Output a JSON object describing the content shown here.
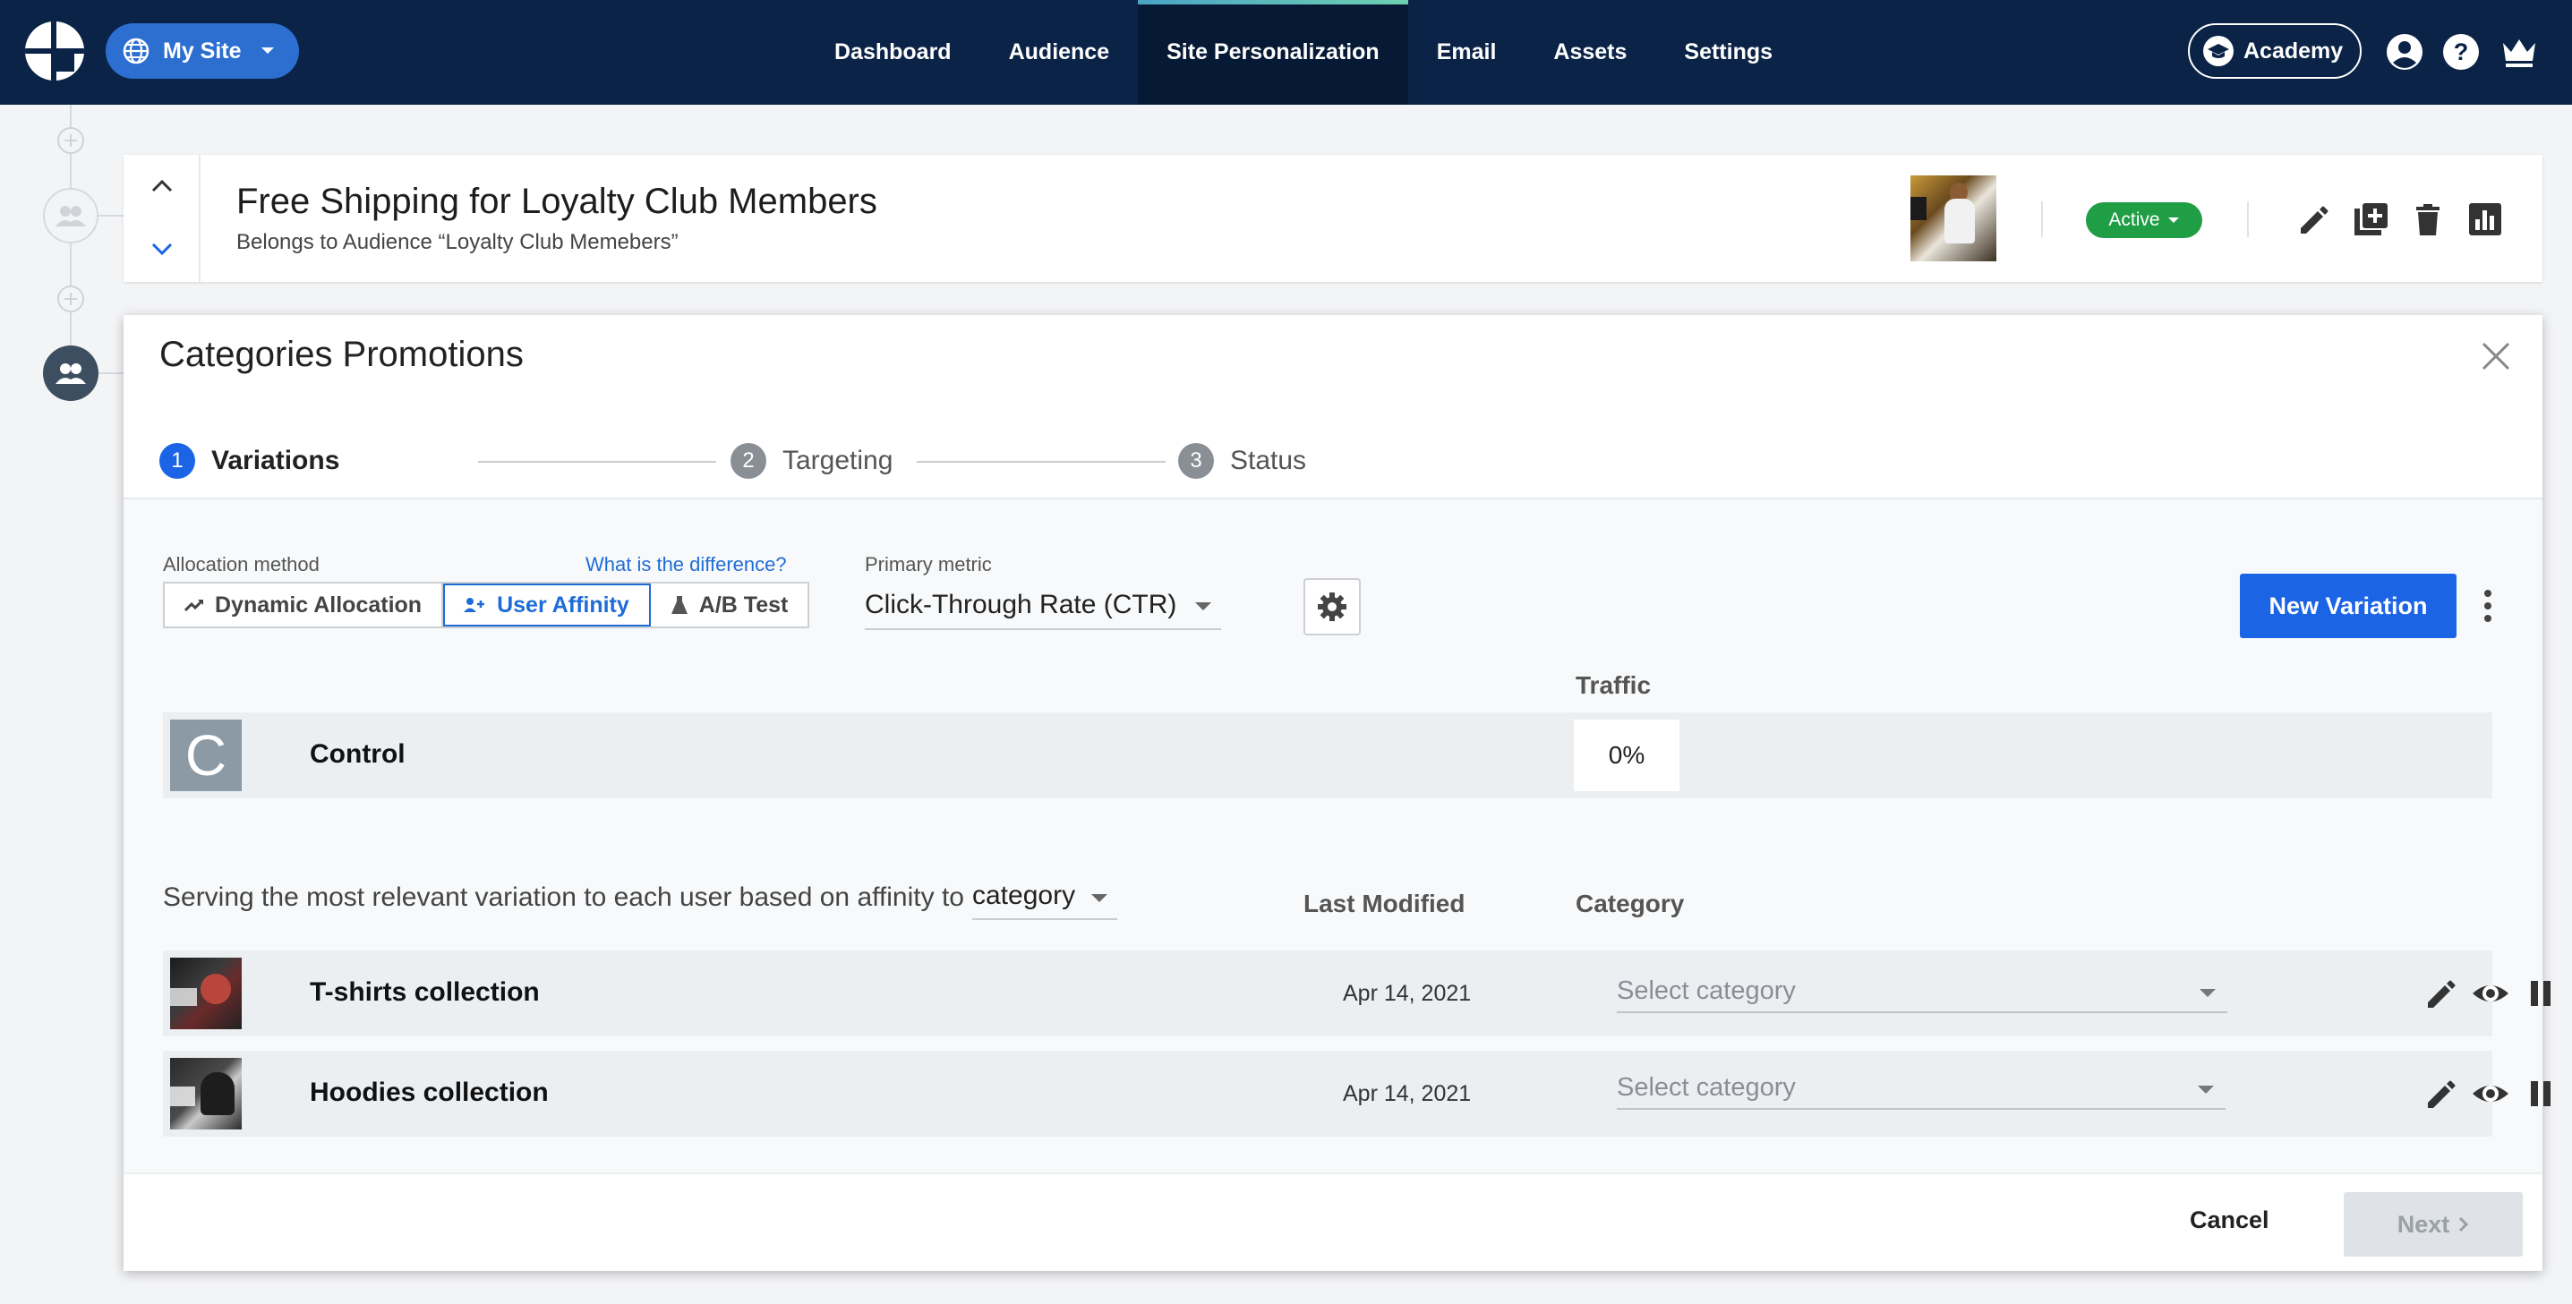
{
  "topbar": {
    "site_label": "My Site",
    "nav": [
      "Dashboard",
      "Audience",
      "Site Personalization",
      "Email",
      "Assets",
      "Settings"
    ],
    "active_nav": "Site Personalization",
    "academy_label": "Academy",
    "colors": {
      "background": "#0a2346",
      "site_pill": "#2c6fd1"
    },
    "icons": [
      "globe-icon",
      "caret-down-icon",
      "academy-icon",
      "account-icon",
      "help-icon",
      "crown-icon"
    ]
  },
  "campaign": {
    "title": "Free Shipping for Loyalty Club Members",
    "subtitle": "Belongs to Audience “Loyalty Club Memebers”",
    "status": "Active",
    "status_color": "#1f9e46",
    "actions": [
      "edit-icon",
      "duplicate-icon",
      "delete-icon",
      "report-icon"
    ]
  },
  "modal": {
    "title": "Categories Promotions",
    "steps": [
      {
        "num": "1",
        "label": "Variations",
        "active": true
      },
      {
        "num": "2",
        "label": "Targeting",
        "active": false
      },
      {
        "num": "3",
        "label": "Status",
        "active": false
      }
    ],
    "allocation": {
      "label": "Allocation method",
      "link": "What is the difference?",
      "options": [
        "Dynamic Allocation",
        "User Affinity",
        "A/B Test"
      ],
      "selected": "User Affinity"
    },
    "metric": {
      "label": "Primary metric",
      "value": "Click-Through Rate (CTR)"
    },
    "new_variation_label": "New Variation",
    "traffic_header": "Traffic",
    "control": {
      "thumb_letter": "C",
      "name": "Control",
      "traffic": "0%"
    },
    "affinity": {
      "text": "Serving the most relevant variation to each user based on affinity to",
      "value": "category"
    },
    "columns": {
      "last_modified": "Last Modified",
      "category": "Category"
    },
    "variations": [
      {
        "name": "T-shirts collection",
        "date": "Apr 14, 2021",
        "category_placeholder": "Select category"
      },
      {
        "name": "Hoodies collection",
        "date": "Apr 14, 2021",
        "category_placeholder": "Select category"
      }
    ],
    "footer": {
      "cancel": "Cancel",
      "next": "Next"
    },
    "accent_color": "#1c64e6"
  }
}
